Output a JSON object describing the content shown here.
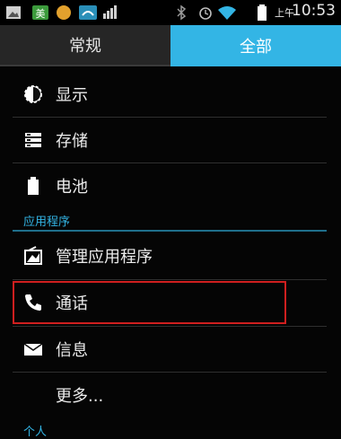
{
  "status_bar": {
    "ampm": "上午",
    "time": "10:53",
    "icons": [
      "picture-notification-icon",
      "app-notification-icon",
      "orange-app-icon",
      "weather-icon",
      "signal-strength-icon",
      "bluetooth-icon",
      "alarm-icon",
      "wifi-icon",
      "battery-icon"
    ]
  },
  "tabs": [
    {
      "label": "常规",
      "selected": false
    },
    {
      "label": "全部",
      "selected": true
    }
  ],
  "colors": {
    "accent": "#33b5e5",
    "highlight": "#d01f1f"
  },
  "device_section": {
    "items": [
      {
        "label": "显示",
        "icon": "brightness-icon"
      },
      {
        "label": "存储",
        "icon": "storage-icon"
      },
      {
        "label": "电池",
        "icon": "battery-icon"
      }
    ]
  },
  "apps_section": {
    "header": "应用程序",
    "items": [
      {
        "label": "管理应用程序",
        "icon": "manage-apps-icon"
      },
      {
        "label": "通话",
        "icon": "phone-icon",
        "highlighted": true
      },
      {
        "label": "信息",
        "icon": "message-icon"
      },
      {
        "label": "更多...",
        "icon": ""
      }
    ]
  },
  "personal_section": {
    "header": "个人"
  }
}
